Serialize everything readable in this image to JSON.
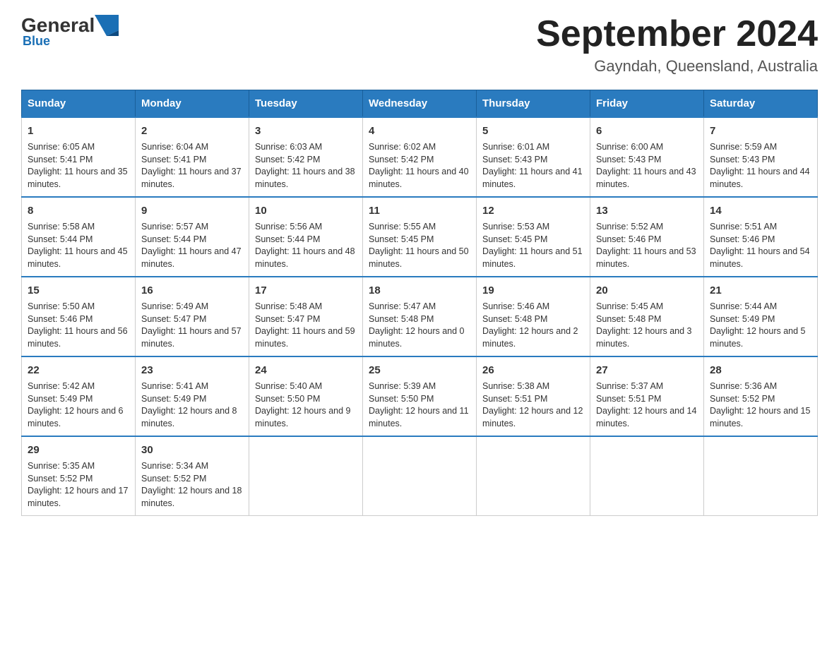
{
  "logo": {
    "general": "General",
    "blue": "Blue"
  },
  "header": {
    "month": "September 2024",
    "location": "Gayndah, Queensland, Australia"
  },
  "days_of_week": [
    "Sunday",
    "Monday",
    "Tuesday",
    "Wednesday",
    "Thursday",
    "Friday",
    "Saturday"
  ],
  "weeks": [
    [
      {
        "day": "1",
        "sunrise": "Sunrise: 6:05 AM",
        "sunset": "Sunset: 5:41 PM",
        "daylight": "Daylight: 11 hours and 35 minutes."
      },
      {
        "day": "2",
        "sunrise": "Sunrise: 6:04 AM",
        "sunset": "Sunset: 5:41 PM",
        "daylight": "Daylight: 11 hours and 37 minutes."
      },
      {
        "day": "3",
        "sunrise": "Sunrise: 6:03 AM",
        "sunset": "Sunset: 5:42 PM",
        "daylight": "Daylight: 11 hours and 38 minutes."
      },
      {
        "day": "4",
        "sunrise": "Sunrise: 6:02 AM",
        "sunset": "Sunset: 5:42 PM",
        "daylight": "Daylight: 11 hours and 40 minutes."
      },
      {
        "day": "5",
        "sunrise": "Sunrise: 6:01 AM",
        "sunset": "Sunset: 5:43 PM",
        "daylight": "Daylight: 11 hours and 41 minutes."
      },
      {
        "day": "6",
        "sunrise": "Sunrise: 6:00 AM",
        "sunset": "Sunset: 5:43 PM",
        "daylight": "Daylight: 11 hours and 43 minutes."
      },
      {
        "day": "7",
        "sunrise": "Sunrise: 5:59 AM",
        "sunset": "Sunset: 5:43 PM",
        "daylight": "Daylight: 11 hours and 44 minutes."
      }
    ],
    [
      {
        "day": "8",
        "sunrise": "Sunrise: 5:58 AM",
        "sunset": "Sunset: 5:44 PM",
        "daylight": "Daylight: 11 hours and 45 minutes."
      },
      {
        "day": "9",
        "sunrise": "Sunrise: 5:57 AM",
        "sunset": "Sunset: 5:44 PM",
        "daylight": "Daylight: 11 hours and 47 minutes."
      },
      {
        "day": "10",
        "sunrise": "Sunrise: 5:56 AM",
        "sunset": "Sunset: 5:44 PM",
        "daylight": "Daylight: 11 hours and 48 minutes."
      },
      {
        "day": "11",
        "sunrise": "Sunrise: 5:55 AM",
        "sunset": "Sunset: 5:45 PM",
        "daylight": "Daylight: 11 hours and 50 minutes."
      },
      {
        "day": "12",
        "sunrise": "Sunrise: 5:53 AM",
        "sunset": "Sunset: 5:45 PM",
        "daylight": "Daylight: 11 hours and 51 minutes."
      },
      {
        "day": "13",
        "sunrise": "Sunrise: 5:52 AM",
        "sunset": "Sunset: 5:46 PM",
        "daylight": "Daylight: 11 hours and 53 minutes."
      },
      {
        "day": "14",
        "sunrise": "Sunrise: 5:51 AM",
        "sunset": "Sunset: 5:46 PM",
        "daylight": "Daylight: 11 hours and 54 minutes."
      }
    ],
    [
      {
        "day": "15",
        "sunrise": "Sunrise: 5:50 AM",
        "sunset": "Sunset: 5:46 PM",
        "daylight": "Daylight: 11 hours and 56 minutes."
      },
      {
        "day": "16",
        "sunrise": "Sunrise: 5:49 AM",
        "sunset": "Sunset: 5:47 PM",
        "daylight": "Daylight: 11 hours and 57 minutes."
      },
      {
        "day": "17",
        "sunrise": "Sunrise: 5:48 AM",
        "sunset": "Sunset: 5:47 PM",
        "daylight": "Daylight: 11 hours and 59 minutes."
      },
      {
        "day": "18",
        "sunrise": "Sunrise: 5:47 AM",
        "sunset": "Sunset: 5:48 PM",
        "daylight": "Daylight: 12 hours and 0 minutes."
      },
      {
        "day": "19",
        "sunrise": "Sunrise: 5:46 AM",
        "sunset": "Sunset: 5:48 PM",
        "daylight": "Daylight: 12 hours and 2 minutes."
      },
      {
        "day": "20",
        "sunrise": "Sunrise: 5:45 AM",
        "sunset": "Sunset: 5:48 PM",
        "daylight": "Daylight: 12 hours and 3 minutes."
      },
      {
        "day": "21",
        "sunrise": "Sunrise: 5:44 AM",
        "sunset": "Sunset: 5:49 PM",
        "daylight": "Daylight: 12 hours and 5 minutes."
      }
    ],
    [
      {
        "day": "22",
        "sunrise": "Sunrise: 5:42 AM",
        "sunset": "Sunset: 5:49 PM",
        "daylight": "Daylight: 12 hours and 6 minutes."
      },
      {
        "day": "23",
        "sunrise": "Sunrise: 5:41 AM",
        "sunset": "Sunset: 5:49 PM",
        "daylight": "Daylight: 12 hours and 8 minutes."
      },
      {
        "day": "24",
        "sunrise": "Sunrise: 5:40 AM",
        "sunset": "Sunset: 5:50 PM",
        "daylight": "Daylight: 12 hours and 9 minutes."
      },
      {
        "day": "25",
        "sunrise": "Sunrise: 5:39 AM",
        "sunset": "Sunset: 5:50 PM",
        "daylight": "Daylight: 12 hours and 11 minutes."
      },
      {
        "day": "26",
        "sunrise": "Sunrise: 5:38 AM",
        "sunset": "Sunset: 5:51 PM",
        "daylight": "Daylight: 12 hours and 12 minutes."
      },
      {
        "day": "27",
        "sunrise": "Sunrise: 5:37 AM",
        "sunset": "Sunset: 5:51 PM",
        "daylight": "Daylight: 12 hours and 14 minutes."
      },
      {
        "day": "28",
        "sunrise": "Sunrise: 5:36 AM",
        "sunset": "Sunset: 5:52 PM",
        "daylight": "Daylight: 12 hours and 15 minutes."
      }
    ],
    [
      {
        "day": "29",
        "sunrise": "Sunrise: 5:35 AM",
        "sunset": "Sunset: 5:52 PM",
        "daylight": "Daylight: 12 hours and 17 minutes."
      },
      {
        "day": "30",
        "sunrise": "Sunrise: 5:34 AM",
        "sunset": "Sunset: 5:52 PM",
        "daylight": "Daylight: 12 hours and 18 minutes."
      },
      null,
      null,
      null,
      null,
      null
    ]
  ]
}
